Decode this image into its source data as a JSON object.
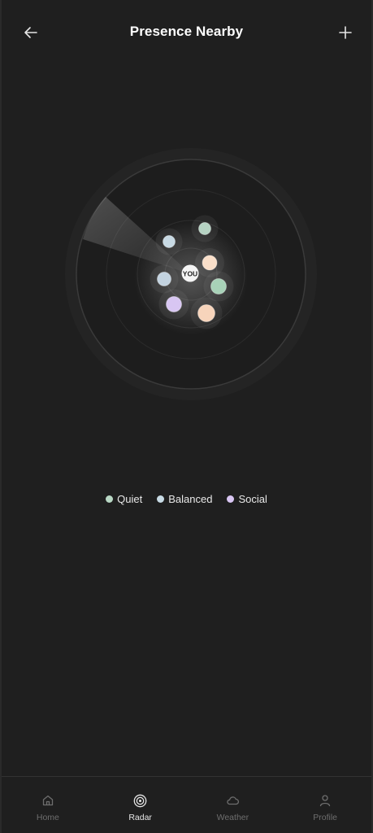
{
  "header": {
    "title": "Presence Nearby",
    "back_icon": "arrow-left-icon",
    "add_icon": "plus-icon"
  },
  "radar": {
    "center_label": "YOU",
    "dots": [
      {
        "type": "Quiet",
        "color": "#b6d3c3"
      },
      {
        "type": "Balanced",
        "color": "#c7d9e3"
      },
      {
        "type": "Balanced",
        "color": "#fadfc9"
      },
      {
        "type": "Balanced",
        "color": "#c3d3e0"
      },
      {
        "type": "Quiet",
        "color": "#a8d2b8"
      },
      {
        "type": "Social",
        "color": "#d8c6f2"
      },
      {
        "type": "Balanced",
        "color": "#f7d4bb"
      }
    ]
  },
  "legend": [
    {
      "label": "Quiet",
      "color": "#b9d8c5"
    },
    {
      "label": "Balanced",
      "color": "#c8dbe5"
    },
    {
      "label": "Social",
      "color": "#d9c6f3"
    }
  ],
  "tabs": [
    {
      "label": "Home",
      "icon": "home-icon",
      "active": false
    },
    {
      "label": "Radar",
      "icon": "radar-icon",
      "active": true
    },
    {
      "label": "Weather",
      "icon": "cloud-icon",
      "active": false
    },
    {
      "label": "Profile",
      "icon": "user-icon",
      "active": false
    }
  ]
}
